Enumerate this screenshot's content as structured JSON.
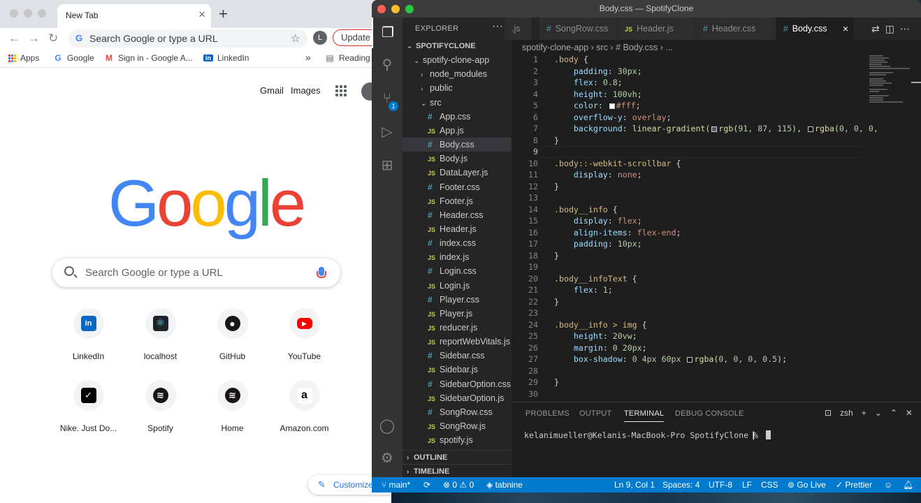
{
  "chrome": {
    "tab": {
      "title": "New Tab",
      "close": "×"
    },
    "new_tab": "+",
    "omnibox": {
      "icon": "G",
      "text": "Search Google or type a URL",
      "star": "☆"
    },
    "avatar": "L",
    "update_label": "Update",
    "bookmarks": [
      {
        "label": "Apps",
        "icon": "apps"
      },
      {
        "label": "Google",
        "icon": "G"
      },
      {
        "label": "Sign in - Google A...",
        "icon": "M"
      },
      {
        "label": "LinkedIn",
        "icon": "in"
      }
    ],
    "bookmarks_more": "»",
    "reading_list": "Reading",
    "header_links": {
      "gmail": "Gmail",
      "images": "Images"
    },
    "logo": [
      "G",
      "o",
      "o",
      "g",
      "l",
      "e"
    ],
    "search_placeholder": "Search Google or type a URL",
    "shortcuts": [
      {
        "label": "LinkedIn",
        "icon": "in",
        "color": "#0a66c2"
      },
      {
        "label": "localhost",
        "icon": "⚛",
        "color": "#61dafb"
      },
      {
        "label": "GitHub",
        "icon": "●",
        "color": "#181717"
      },
      {
        "label": "YouTube",
        "icon": "▶",
        "color": "#ff0000"
      },
      {
        "label": "Nike. Just Do...",
        "icon": "✓",
        "color": "#000000"
      },
      {
        "label": "Spotify",
        "icon": "≋",
        "color": "#191414"
      },
      {
        "label": "Home",
        "icon": "≋",
        "color": "#191414"
      },
      {
        "label": "Amazon.com",
        "icon": "a",
        "color": "#232f3e"
      }
    ],
    "customize_label": "Customize"
  },
  "vscode": {
    "window_title": "Body.css — SpotifyClone",
    "sidebar": {
      "header": "EXPLORER",
      "more": "···",
      "tree": [
        {
          "label": "SPOTIFYCLONE",
          "type": "root",
          "indent": 0
        },
        {
          "label": "spotify-clone-app",
          "type": "folder-open",
          "indent": 1
        },
        {
          "label": "node_modules",
          "type": "folder",
          "indent": 2
        },
        {
          "label": "public",
          "type": "folder",
          "indent": 2
        },
        {
          "label": "src",
          "type": "folder-open",
          "indent": 2
        },
        {
          "label": "App.css",
          "type": "css",
          "indent": 3
        },
        {
          "label": "App.js",
          "type": "js",
          "indent": 3
        },
        {
          "label": "Body.css",
          "type": "css",
          "indent": 3,
          "selected": true
        },
        {
          "label": "Body.js",
          "type": "js",
          "indent": 3
        },
        {
          "label": "DataLayer.js",
          "type": "js",
          "indent": 3
        },
        {
          "label": "Footer.css",
          "type": "css",
          "indent": 3
        },
        {
          "label": "Footer.js",
          "type": "js",
          "indent": 3
        },
        {
          "label": "Header.css",
          "type": "css",
          "indent": 3
        },
        {
          "label": "Header.js",
          "type": "js",
          "indent": 3
        },
        {
          "label": "index.css",
          "type": "css",
          "indent": 3
        },
        {
          "label": "index.js",
          "type": "js",
          "indent": 3
        },
        {
          "label": "Login.css",
          "type": "css",
          "indent": 3
        },
        {
          "label": "Login.js",
          "type": "js",
          "indent": 3
        },
        {
          "label": "Player.css",
          "type": "css",
          "indent": 3
        },
        {
          "label": "Player.js",
          "type": "js",
          "indent": 3
        },
        {
          "label": "reducer.js",
          "type": "js",
          "indent": 3
        },
        {
          "label": "reportWebVitals.js",
          "type": "js",
          "indent": 3
        },
        {
          "label": "Sidebar.css",
          "type": "css",
          "indent": 3
        },
        {
          "label": "Sidebar.js",
          "type": "js",
          "indent": 3
        },
        {
          "label": "SidebarOption.css",
          "type": "css",
          "indent": 3
        },
        {
          "label": "SidebarOption.js",
          "type": "js",
          "indent": 3
        },
        {
          "label": "SongRow.css",
          "type": "css",
          "indent": 3
        },
        {
          "label": "SongRow.js",
          "type": "js",
          "indent": 3
        },
        {
          "label": "spotify.js",
          "type": "js",
          "indent": 3
        }
      ],
      "outline": "OUTLINE",
      "timeline": "TIMELINE"
    },
    "scm_badge": "1",
    "tabs": [
      {
        "label": ".js",
        "type": "none"
      },
      {
        "label": "SongRow.css",
        "type": "css"
      },
      {
        "label": "Header.js",
        "type": "js"
      },
      {
        "label": "Header.css",
        "type": "css"
      },
      {
        "label": "Body.css",
        "type": "css",
        "active": true
      }
    ],
    "tab_close": "×",
    "breadcrumb": "spotify-clone-app  ›  src  ›  # Body.css  ›  ...",
    "code": [
      [
        {
          "t": ".body",
          "c": "sel"
        },
        {
          "t": " {",
          "c": "p"
        }
      ],
      [
        {
          "t": "    ",
          "c": "p"
        },
        {
          "t": "padding",
          "c": "prop"
        },
        {
          "t": ": ",
          "c": "p"
        },
        {
          "t": "30px",
          "c": "num"
        },
        {
          "t": ";",
          "c": "p"
        }
      ],
      [
        {
          "t": "    ",
          "c": "p"
        },
        {
          "t": "flex",
          "c": "prop"
        },
        {
          "t": ": ",
          "c": "p"
        },
        {
          "t": "0.8",
          "c": "num"
        },
        {
          "t": ";",
          "c": "p"
        }
      ],
      [
        {
          "t": "    ",
          "c": "p"
        },
        {
          "t": "height",
          "c": "prop"
        },
        {
          "t": ": ",
          "c": "p"
        },
        {
          "t": "100vh",
          "c": "num"
        },
        {
          "t": ";",
          "c": "p"
        }
      ],
      [
        {
          "t": "    ",
          "c": "p"
        },
        {
          "t": "color",
          "c": "prop"
        },
        {
          "t": ": ",
          "c": "p"
        },
        {
          "t": "",
          "c": "sw",
          "color": "#ffffff"
        },
        {
          "t": "#fff",
          "c": "val"
        },
        {
          "t": ";",
          "c": "p"
        }
      ],
      [
        {
          "t": "    ",
          "c": "p"
        },
        {
          "t": "overflow-y",
          "c": "prop"
        },
        {
          "t": ": ",
          "c": "p"
        },
        {
          "t": "overlay",
          "c": "val"
        },
        {
          "t": ";",
          "c": "p"
        }
      ],
      [
        {
          "t": "    ",
          "c": "p"
        },
        {
          "t": "background",
          "c": "prop"
        },
        {
          "t": ": ",
          "c": "p"
        },
        {
          "t": "linear-gradient(",
          "c": "fn"
        },
        {
          "t": "",
          "c": "sw",
          "color": "#5b5773"
        },
        {
          "t": "rgb(",
          "c": "fn"
        },
        {
          "t": "91, 87, 115",
          "c": "num"
        },
        {
          "t": "), ",
          "c": "p"
        },
        {
          "t": "",
          "c": "sw",
          "color": "#000000"
        },
        {
          "t": "rgba(",
          "c": "fn"
        },
        {
          "t": "0, 0, 0,",
          "c": "num"
        }
      ],
      [
        {
          "t": "}",
          "c": "p"
        }
      ],
      [],
      [
        {
          "t": ".body::-webkit-scrollbar",
          "c": "sel"
        },
        {
          "t": " {",
          "c": "p"
        }
      ],
      [
        {
          "t": "    ",
          "c": "p"
        },
        {
          "t": "display",
          "c": "prop"
        },
        {
          "t": ": ",
          "c": "p"
        },
        {
          "t": "none",
          "c": "val"
        },
        {
          "t": ";",
          "c": "p"
        }
      ],
      [
        {
          "t": "}",
          "c": "p"
        }
      ],
      [],
      [
        {
          "t": ".body__info",
          "c": "sel"
        },
        {
          "t": " {",
          "c": "p"
        }
      ],
      [
        {
          "t": "    ",
          "c": "p"
        },
        {
          "t": "display",
          "c": "prop"
        },
        {
          "t": ": ",
          "c": "p"
        },
        {
          "t": "flex",
          "c": "val"
        },
        {
          "t": ";",
          "c": "p"
        }
      ],
      [
        {
          "t": "    ",
          "c": "p"
        },
        {
          "t": "align-items",
          "c": "prop"
        },
        {
          "t": ": ",
          "c": "p"
        },
        {
          "t": "flex-end",
          "c": "val"
        },
        {
          "t": ";",
          "c": "p"
        }
      ],
      [
        {
          "t": "    ",
          "c": "p"
        },
        {
          "t": "padding",
          "c": "prop"
        },
        {
          "t": ": ",
          "c": "p"
        },
        {
          "t": "10px",
          "c": "num"
        },
        {
          "t": ";",
          "c": "p"
        }
      ],
      [
        {
          "t": "}",
          "c": "p"
        }
      ],
      [],
      [
        {
          "t": ".body__infoText",
          "c": "sel"
        },
        {
          "t": " {",
          "c": "p"
        }
      ],
      [
        {
          "t": "    ",
          "c": "p"
        },
        {
          "t": "flex",
          "c": "prop"
        },
        {
          "t": ": ",
          "c": "p"
        },
        {
          "t": "1",
          "c": "num"
        },
        {
          "t": ";",
          "c": "p"
        }
      ],
      [
        {
          "t": "}",
          "c": "p"
        }
      ],
      [],
      [
        {
          "t": ".body__info > img",
          "c": "sel"
        },
        {
          "t": " {",
          "c": "p"
        }
      ],
      [
        {
          "t": "    ",
          "c": "p"
        },
        {
          "t": "height",
          "c": "prop"
        },
        {
          "t": ": ",
          "c": "p"
        },
        {
          "t": "20vw",
          "c": "num"
        },
        {
          "t": ";",
          "c": "p"
        }
      ],
      [
        {
          "t": "    ",
          "c": "p"
        },
        {
          "t": "margin",
          "c": "prop"
        },
        {
          "t": ": ",
          "c": "p"
        },
        {
          "t": "0 20px",
          "c": "num"
        },
        {
          "t": ";",
          "c": "p"
        }
      ],
      [
        {
          "t": "    ",
          "c": "p"
        },
        {
          "t": "box-shadow",
          "c": "prop"
        },
        {
          "t": ": ",
          "c": "p"
        },
        {
          "t": "0 4px 60px ",
          "c": "num"
        },
        {
          "t": "",
          "c": "sw",
          "color": "#000000"
        },
        {
          "t": "rgba(",
          "c": "fn"
        },
        {
          "t": "0, 0, 0, 0.5",
          "c": "num"
        },
        {
          "t": ");",
          "c": "p"
        }
      ],
      [],
      [
        {
          "t": "}",
          "c": "p"
        }
      ],
      []
    ],
    "current_line": 9,
    "panel": {
      "tabs": [
        "PROBLEMS",
        "OUTPUT",
        "TERMINAL",
        "DEBUG CONSOLE"
      ],
      "active_tab": "TERMINAL",
      "shell": "zsh",
      "prompt": "kelanimueller@Kelanis-MacBook-Pro SpotifyClone % "
    },
    "status": {
      "branch": "main*",
      "errors": "0",
      "warnings": "0",
      "tabnine": "tabnine",
      "position": "Ln 9, Col 1",
      "spaces": "Spaces: 4",
      "encoding": "UTF-8",
      "eol": "LF",
      "language": "CSS",
      "golive": "Go Live",
      "prettier": "Prettier"
    },
    "colors": {
      "accent": "#007acc",
      "editor_bg": "#1e1e1e",
      "sidebar_bg": "#252526"
    }
  }
}
